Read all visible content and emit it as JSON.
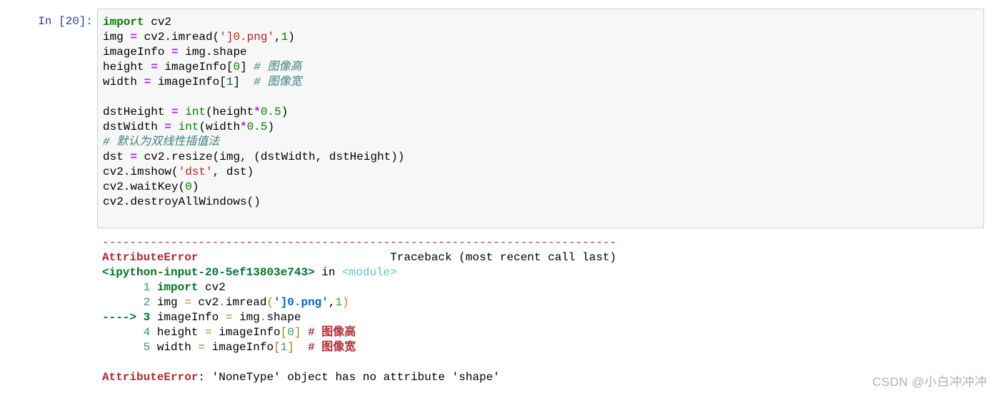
{
  "cell": {
    "prompt": "In [20]:",
    "input_lines": [
      [
        {
          "t": "import",
          "c": "kw"
        },
        {
          "t": " cv2",
          "c": ""
        }
      ],
      [
        {
          "t": "img ",
          "c": ""
        },
        {
          "t": "=",
          "c": "op"
        },
        {
          "t": " cv2.imread(",
          "c": ""
        },
        {
          "t": "']0.png'",
          "c": "str"
        },
        {
          "t": ",",
          "c": ""
        },
        {
          "t": "1",
          "c": "num"
        },
        {
          "t": ")",
          "c": ""
        }
      ],
      [
        {
          "t": "imageInfo ",
          "c": ""
        },
        {
          "t": "=",
          "c": "op"
        },
        {
          "t": " img.shape",
          "c": ""
        }
      ],
      [
        {
          "t": "height ",
          "c": ""
        },
        {
          "t": "=",
          "c": "op"
        },
        {
          "t": " imageInfo[",
          "c": ""
        },
        {
          "t": "0",
          "c": "num"
        },
        {
          "t": "] ",
          "c": ""
        },
        {
          "t": "# 图像高",
          "c": "cmt"
        }
      ],
      [
        {
          "t": "width ",
          "c": ""
        },
        {
          "t": "=",
          "c": "op"
        },
        {
          "t": " imageInfo[",
          "c": ""
        },
        {
          "t": "1",
          "c": "num"
        },
        {
          "t": "]  ",
          "c": ""
        },
        {
          "t": "# 图像宽",
          "c": "cmt"
        }
      ],
      [],
      [
        {
          "t": "dstHeight ",
          "c": ""
        },
        {
          "t": "=",
          "c": "op"
        },
        {
          "t": " ",
          "c": ""
        },
        {
          "t": "int",
          "c": "builtin"
        },
        {
          "t": "(height",
          "c": ""
        },
        {
          "t": "*",
          "c": "op"
        },
        {
          "t": "0.5",
          "c": "num"
        },
        {
          "t": ")",
          "c": ""
        }
      ],
      [
        {
          "t": "dstWidth ",
          "c": ""
        },
        {
          "t": "=",
          "c": "op"
        },
        {
          "t": " ",
          "c": ""
        },
        {
          "t": "int",
          "c": "builtin"
        },
        {
          "t": "(width",
          "c": ""
        },
        {
          "t": "*",
          "c": "op"
        },
        {
          "t": "0.5",
          "c": "num"
        },
        {
          "t": ")",
          "c": ""
        }
      ],
      [
        {
          "t": "# 默认为双线性插值法",
          "c": "cmt"
        }
      ],
      [
        {
          "t": "dst ",
          "c": ""
        },
        {
          "t": "=",
          "c": "op"
        },
        {
          "t": " cv2.resize(img, (dstWidth, dstHeight))",
          "c": ""
        }
      ],
      [
        {
          "t": "cv2.imshow(",
          "c": ""
        },
        {
          "t": "'dst'",
          "c": "str"
        },
        {
          "t": ", dst)",
          "c": ""
        }
      ],
      [
        {
          "t": "cv2.waitKey(",
          "c": ""
        },
        {
          "t": "0",
          "c": "num"
        },
        {
          "t": ")",
          "c": ""
        }
      ],
      [
        {
          "t": "cv2.destroyAllWindows()",
          "c": ""
        }
      ]
    ],
    "output_lines": [
      [
        {
          "t": "---------------------------------------------------------------------------",
          "c": "dash-red"
        }
      ],
      [
        {
          "t": "AttributeError",
          "c": "err-red"
        },
        {
          "t": "                            Traceback (most recent call last)",
          "c": ""
        }
      ],
      [
        {
          "t": "<ipython-input-20-5ef13803e743>",
          "c": "tb-green"
        },
        {
          "t": " in ",
          "c": ""
        },
        {
          "t": "<module>",
          "c": "tb-cyan"
        }
      ],
      [
        {
          "t": "      1 ",
          "c": "tb-lineno"
        },
        {
          "t": "import",
          "c": "tb-kw"
        },
        {
          "t": " cv2",
          "c": ""
        }
      ],
      [
        {
          "t": "      2 ",
          "c": "tb-lineno"
        },
        {
          "t": "img ",
          "c": ""
        },
        {
          "t": "=",
          "c": "tb-op"
        },
        {
          "t": " cv2",
          "c": ""
        },
        {
          "t": ".",
          "c": "tb-dot"
        },
        {
          "t": "imread",
          "c": ""
        },
        {
          "t": "(",
          "c": "tb-op"
        },
        {
          "t": "']0.png'",
          "c": "tb-str"
        },
        {
          "t": ",",
          "c": ""
        },
        {
          "t": "1",
          "c": "tb-num"
        },
        {
          "t": ")",
          "c": "tb-op"
        }
      ],
      [
        {
          "t": "----> 3 ",
          "c": "tb-arrow"
        },
        {
          "t": "imageInfo ",
          "c": ""
        },
        {
          "t": "=",
          "c": "tb-op"
        },
        {
          "t": " img",
          "c": ""
        },
        {
          "t": ".",
          "c": "tb-dot"
        },
        {
          "t": "shape",
          "c": ""
        }
      ],
      [
        {
          "t": "      4 ",
          "c": "tb-lineno"
        },
        {
          "t": "height ",
          "c": ""
        },
        {
          "t": "=",
          "c": "tb-op"
        },
        {
          "t": " imageInfo",
          "c": ""
        },
        {
          "t": "[",
          "c": "tb-op"
        },
        {
          "t": "0",
          "c": "tb-num"
        },
        {
          "t": "]",
          "c": "tb-op"
        },
        {
          "t": " ",
          "c": ""
        },
        {
          "t": "# 图像高",
          "c": "tb-cmt"
        }
      ],
      [
        {
          "t": "      5 ",
          "c": "tb-lineno"
        },
        {
          "t": "width ",
          "c": ""
        },
        {
          "t": "=",
          "c": "tb-op"
        },
        {
          "t": " imageInfo",
          "c": ""
        },
        {
          "t": "[",
          "c": "tb-op"
        },
        {
          "t": "1",
          "c": "tb-num"
        },
        {
          "t": "]",
          "c": "tb-op"
        },
        {
          "t": "  ",
          "c": ""
        },
        {
          "t": "# 图像宽",
          "c": "tb-cmt"
        }
      ],
      [],
      [
        {
          "t": "AttributeError",
          "c": "err-red"
        },
        {
          "t": ": 'NoneType' object has no attribute 'shape'",
          "c": ""
        }
      ]
    ]
  },
  "watermark": "CSDN @小白冲冲冲"
}
